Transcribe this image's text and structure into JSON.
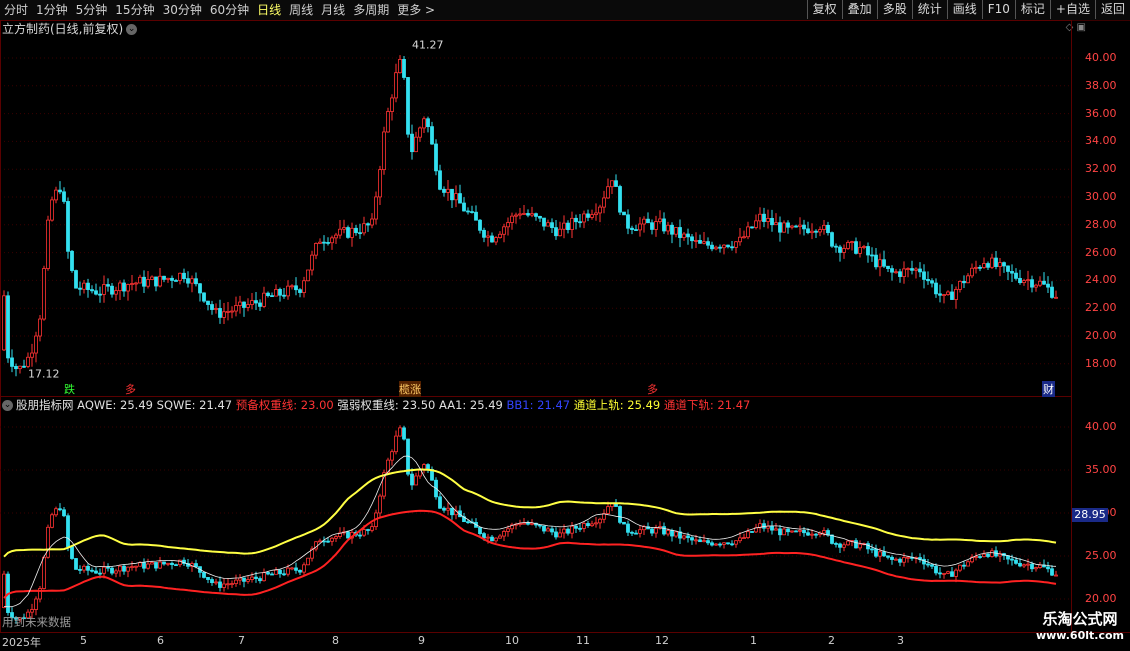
{
  "toolbar": {
    "periods": [
      "分时",
      "1分钟",
      "5分钟",
      "15分钟",
      "30分钟",
      "60分钟",
      "日线",
      "周线",
      "月线",
      "多周期",
      "更多 >"
    ],
    "active": "日线",
    "right_buttons": [
      "复权",
      "叠加",
      "多股",
      "统计",
      "画线",
      "F10",
      "标记",
      "+自选",
      "返回"
    ]
  },
  "title": "立方制药(日线,前复权)",
  "price_axis": [
    "40.00",
    "38.00",
    "36.00",
    "34.00",
    "32.00",
    "30.00",
    "28.00",
    "26.00",
    "24.00",
    "22.00",
    "20.00",
    "18.00"
  ],
  "high_label": "41.27",
  "low_label": "17.12",
  "markers": {
    "die": "跌",
    "duo1": "多",
    "combo": "榄涨",
    "duo2": "多",
    "cai": "财"
  },
  "indicator": {
    "name": "股朋指标网",
    "aqwe_label": "AQWE:",
    "aqwe": "25.49",
    "sqwe_label": "SQWE:",
    "sqwe": "21.47",
    "yb_label": "预备权重线:",
    "yb": "23.00",
    "qr_label": "强弱权重线:",
    "qr": "23.50",
    "aa1_label": "AA1:",
    "aa1": "25.49",
    "bb1_label": "BB1:",
    "bb1": "21.47",
    "up_label": "通道上轨:",
    "up": "25.49",
    "down_label": "通道下轨:",
    "down": "21.47"
  },
  "ind_axis": [
    "40.00",
    "35.00",
    "30.00",
    "25.00",
    "20.00"
  ],
  "price_tag": "28.95",
  "future_note": "用到未来数据",
  "dates": [
    "2025年",
    "5",
    "6",
    "7",
    "8",
    "9",
    "10",
    "11",
    "12",
    "1",
    "2",
    "3"
  ],
  "watermark": {
    "line1": "乐淘公式网",
    "line2": "www.60lt.com"
  },
  "colors": {
    "up": "#ff3333",
    "down": "#33e0f0",
    "channel_up": "#ffff44",
    "channel_down": "#ff2222",
    "bg": "#000000"
  }
}
